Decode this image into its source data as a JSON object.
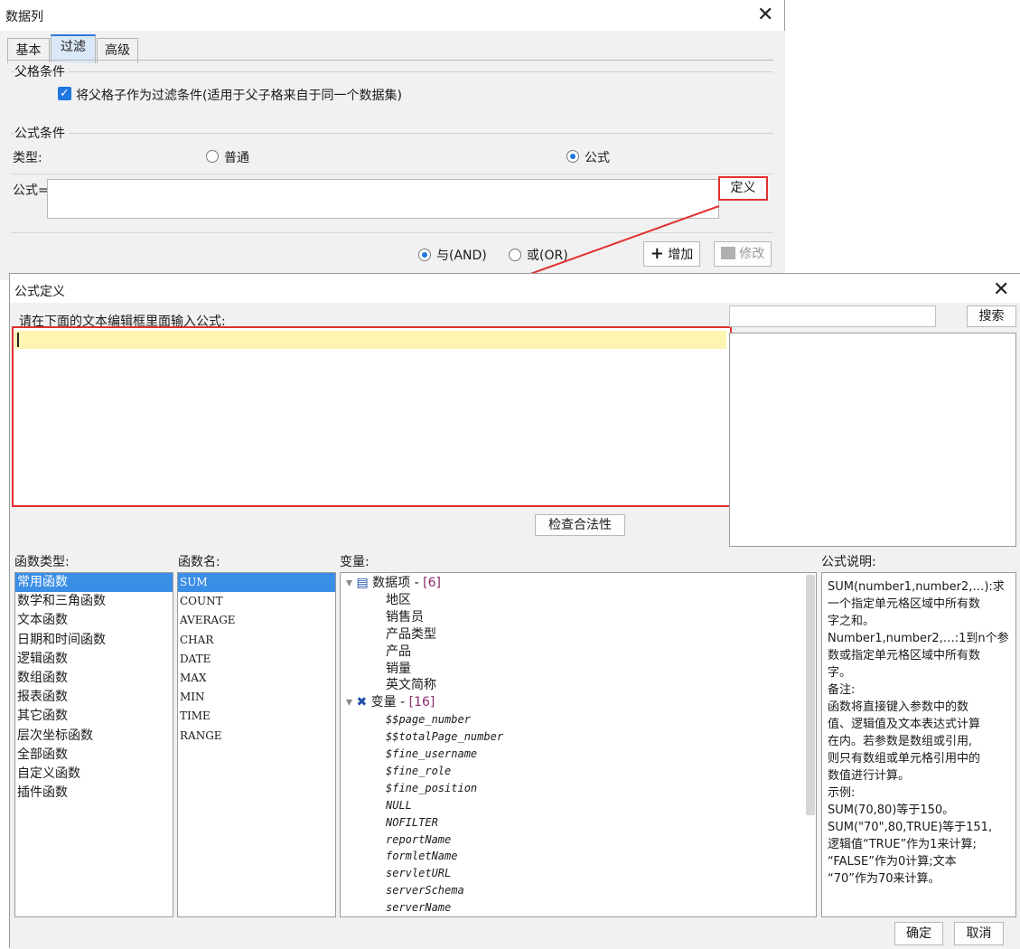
{
  "filter_dialog": {
    "title": "数据列",
    "tabs": [
      {
        "label": "基本",
        "active": false
      },
      {
        "label": "过滤",
        "active": true
      },
      {
        "label": "高级",
        "active": false
      }
    ],
    "parent_condition": {
      "label": "父格条件",
      "checkbox_label": "将父格子作为过滤条件(适用于父子格来自于同一个数据集)",
      "checked": true
    },
    "formula_condition": {
      "label": "公式条件",
      "type_label": "类型:",
      "radio_normal": "普通",
      "radio_formula": "公式",
      "selected": "公式",
      "formula_label": "公式=",
      "define_button": "定义"
    },
    "logic": {
      "and_label": "与(AND)",
      "or_label": "或(OR)",
      "selected": "与(AND)"
    },
    "add_button": "增加",
    "modify_button": "修改"
  },
  "formula_dialog": {
    "title": "公式定义",
    "prompt": "请在下面的文本编辑框里面输入公式:",
    "search_button": "搜索",
    "search_placeholder": "",
    "check_button": "检查合法性",
    "function_types_label": "函数类型:",
    "function_types": [
      "常用函数",
      "数学和三角函数",
      "文本函数",
      "日期和时间函数",
      "逻辑函数",
      "数组函数",
      "报表函数",
      "其它函数",
      "层次坐标函数",
      "全部函数",
      "自定义函数",
      "插件函数"
    ],
    "function_types_selected": 0,
    "function_names_label": "函数名:",
    "function_names": [
      "SUM",
      "COUNT",
      "AVERAGE",
      "CHAR",
      "DATE",
      "MAX",
      "MIN",
      "TIME",
      "RANGE"
    ],
    "function_names_selected": 0,
    "variables_label": "变量:",
    "data_items": {
      "name": "数据项",
      "count": "[6]",
      "children": [
        "地区",
        "销售员",
        "产品类型",
        "产品",
        "销量",
        "英文简称"
      ]
    },
    "variables": {
      "name": "变量",
      "count": "[16]",
      "children": [
        "$$page_number",
        "$$totalPage_number",
        "$fine_username",
        "$fine_role",
        "$fine_position",
        "NULL",
        "NOFILTER",
        "reportName",
        "formletName",
        "servletURL",
        "serverSchema",
        "serverName"
      ]
    },
    "description_label": "公式说明:",
    "description_lines": [
      "SUM(number1,number2,…):求",
      "一个指定单元格区域中所有数",
      "字之和。",
      "Number1,number2,…:1到n个参",
      "数或指定单元格区域中所有数",
      "字。",
      "备注:",
      "函数将直接键入参数中的数",
      "值、逻辑值及文本表达式计算",
      "在内。若参数是数组或引用,",
      "则只有数组或单元格引用中的",
      "数值进行计算。",
      "示例:",
      "SUM(70,80)等于150。",
      "SUM(\"70\",80,TRUE)等于151,",
      "逻辑值“TRUE”作为1来计算;",
      "“FALSE”作为0计算;文本",
      "“70”作为70来计算。"
    ],
    "ok_button": "确定",
    "cancel_button": "取消"
  },
  "colors": {
    "accent": "#1f77e0",
    "selection": "#3a8ee6",
    "highlight_line": "#fdf5b0",
    "annotation_red": "#e23030"
  }
}
